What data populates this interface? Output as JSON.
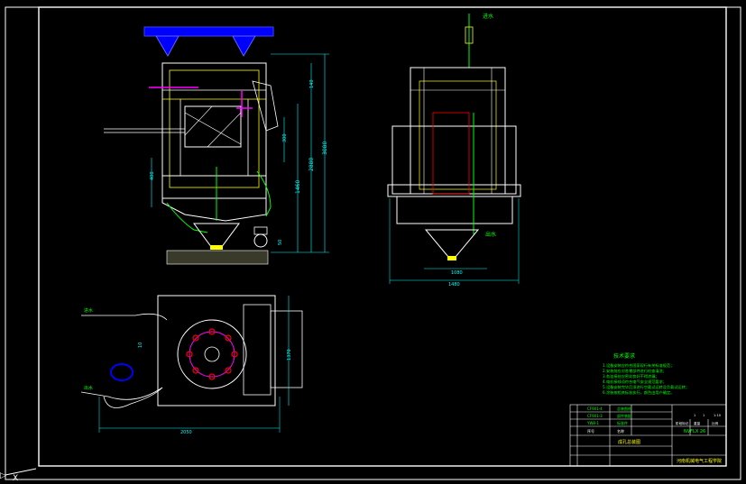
{
  "drawing": {
    "background": "#000000",
    "line_white": "#ffffff",
    "line_yellow": "#ffff00",
    "line_green": "#00ff00",
    "line_cyan": "#00ffff",
    "line_magenta": "#ff00ff",
    "line_blue": "#0000ff",
    "line_red": "#ff0000"
  },
  "labels": {
    "side_view_dim_total": "3080",
    "side_view_dim_height": "2880",
    "side_view_dim_inner": "1460",
    "side_view_dim_small": "140",
    "side_view_dim_mid": "300",
    "side_view_dim_left": "400",
    "side_view_dim_bottom": "50",
    "front_view_top_note": "进水",
    "front_view_dim_width": "1480",
    "front_view_dim_inner": "1080",
    "front_view_side_note": "出水",
    "plan_view_dim_width": "2050",
    "plan_view_dim_height": "1370",
    "plan_view_left_top": "进水",
    "plan_view_left_bottom": "出水",
    "plan_view_dim_small": "10"
  },
  "notes": {
    "title": "技术要求",
    "lines": [
      "1.设备安装应符合国家现行有关标准规范；",
      "2.安装前应对各零部件进行检查清洗；",
      "3.各连接处应密封良好不得渗漏；",
      "4.电机接线须符合电气安全规范要求；",
      "5.设备安装完毕后须进行空载试运转及负载试运转；",
      "6.涂装按相关标准执行，颜色由用户确定。"
    ]
  },
  "title_block": {
    "code": "NVFLX 26",
    "drawing_name": "成孔总装图",
    "company": "河南机械电气工程学院",
    "rows_left": [
      "CF901-4",
      "CF901-3",
      "YW8-1",
      "序号"
    ],
    "rows_mid": [
      "总装图纸",
      "部件装配",
      "标准件",
      "名称"
    ],
    "header_cells": [
      "标记",
      "处数",
      "分区",
      "更改文件号",
      "签名",
      "年月日"
    ],
    "right_cells": [
      "阶段标记",
      "重量",
      "比例"
    ],
    "scale_labels": [
      "1",
      "1",
      "1:10"
    ]
  }
}
